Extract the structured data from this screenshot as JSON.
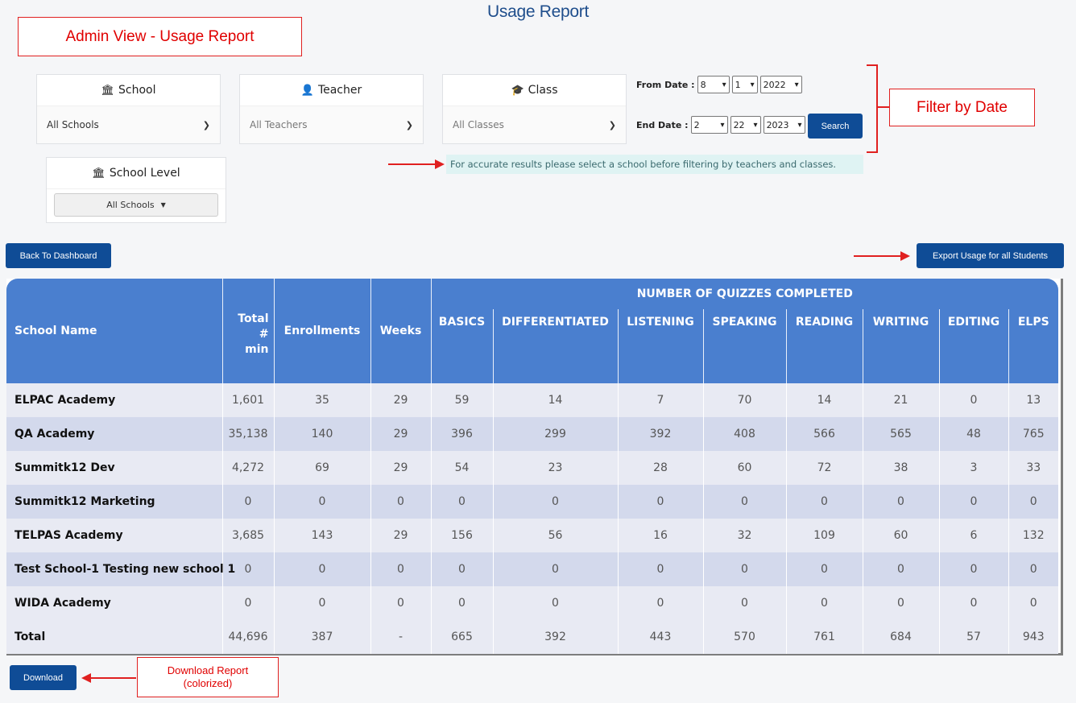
{
  "page_title": "Usage Report",
  "annotations": {
    "admin_view": "Admin View - Usage Report",
    "filter_by_date": "Filter by Date",
    "download_report": "Download Report\n(colorized)"
  },
  "filters": {
    "school": {
      "label": "School",
      "value": "All Schools"
    },
    "teacher": {
      "label": "Teacher",
      "value": "All Teachers"
    },
    "class": {
      "label": "Class",
      "value": "All Classes"
    },
    "school_level": {
      "label": "School Level",
      "value": "All Schools"
    }
  },
  "dates": {
    "from_label": "From Date :",
    "from_month": "8",
    "from_day": "1",
    "from_year": "2022",
    "end_label": "End Date :",
    "end_month": "2",
    "end_day": "22",
    "end_year": "2023",
    "search_label": "Search"
  },
  "notice": "For accurate results please select a school before filtering by teachers and classes.",
  "buttons": {
    "back": "Back To Dashboard",
    "export": "Export Usage for all Students",
    "download": "Download"
  },
  "table": {
    "group_header": "NUMBER OF QUIZZES COMPLETED",
    "headers": {
      "school_name": "School Name",
      "total_min": "Total\n#\nmin",
      "enrollments": "Enrollments",
      "weeks": "Weeks",
      "basics": "BASICS",
      "differentiated": "DIFFERENTIATED",
      "listening": "LISTENING",
      "speaking": "SPEAKING",
      "reading": "READING",
      "writing": "WRITING",
      "editing": "EDITING",
      "elps": "ELPS"
    },
    "rows": [
      [
        "ELPAC Academy",
        "1,601",
        "35",
        "29",
        "59",
        "14",
        "7",
        "70",
        "14",
        "21",
        "0",
        "13"
      ],
      [
        "QA Academy",
        "35,138",
        "140",
        "29",
        "396",
        "299",
        "392",
        "408",
        "566",
        "565",
        "48",
        "765"
      ],
      [
        "Summitk12 Dev",
        "4,272",
        "69",
        "29",
        "54",
        "23",
        "28",
        "60",
        "72",
        "38",
        "3",
        "33"
      ],
      [
        "Summitk12 Marketing",
        "0",
        "0",
        "0",
        "0",
        "0",
        "0",
        "0",
        "0",
        "0",
        "0",
        "0"
      ],
      [
        "TELPAS Academy",
        "3,685",
        "143",
        "29",
        "156",
        "56",
        "16",
        "32",
        "109",
        "60",
        "6",
        "132"
      ],
      [
        "Test School-1 Testing new school 1",
        "0",
        "0",
        "0",
        "0",
        "0",
        "0",
        "0",
        "0",
        "0",
        "0",
        "0"
      ],
      [
        "WIDA Academy",
        "0",
        "0",
        "0",
        "0",
        "0",
        "0",
        "0",
        "0",
        "0",
        "0",
        "0"
      ],
      [
        "Total",
        "44,696",
        "387",
        "-",
        "665",
        "392",
        "443",
        "570",
        "761",
        "684",
        "57",
        "943"
      ]
    ]
  }
}
